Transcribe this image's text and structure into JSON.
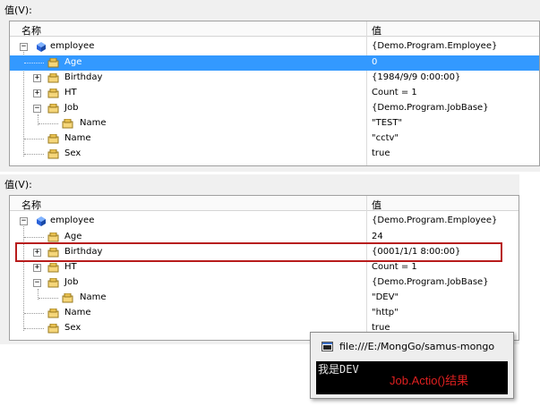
{
  "panel_top": {
    "label": "值(V):",
    "col_name": "名称",
    "col_value": "值",
    "rows": [
      {
        "name": "employee",
        "value": "{Demo.Program.Employee}"
      },
      {
        "name": "Age",
        "value": "0"
      },
      {
        "name": "Birthday",
        "value": "{1984/9/9 0:00:00}"
      },
      {
        "name": "HT",
        "value": "Count = 1"
      },
      {
        "name": "Job",
        "value": "{Demo.Program.JobBase}"
      },
      {
        "name": "Name",
        "value": "\"TEST\""
      },
      {
        "name": "Name",
        "value": "\"cctv\""
      },
      {
        "name": "Sex",
        "value": "true"
      }
    ]
  },
  "panel_bottom": {
    "label": "值(V):",
    "col_name": "名称",
    "col_value": "值",
    "rows": [
      {
        "name": "employee",
        "value": "{Demo.Program.Employee}"
      },
      {
        "name": "Age",
        "value": "24"
      },
      {
        "name": "Birthday",
        "value": "{0001/1/1 8:00:00}"
      },
      {
        "name": "HT",
        "value": "Count = 1"
      },
      {
        "name": "Job",
        "value": "{Demo.Program.JobBase}"
      },
      {
        "name": "Name",
        "value": "\"DEV\""
      },
      {
        "name": "Name",
        "value": "\"http\""
      },
      {
        "name": "Sex",
        "value": "true"
      }
    ]
  },
  "popup": {
    "title": "file:///E:/MongGo/samus-mongo",
    "console_output": "我是DEV",
    "annotation": "Job.Actio()结果"
  },
  "colors": {
    "selection": "#3399ff",
    "highlight_border": "#b81c1c",
    "annotation_text": "#e02020"
  },
  "icons": {
    "object": "cube-icon",
    "property": "property-icon",
    "expand": "expand-plus-icon",
    "collapse": "collapse-minus-icon",
    "console": "console-app-icon"
  }
}
